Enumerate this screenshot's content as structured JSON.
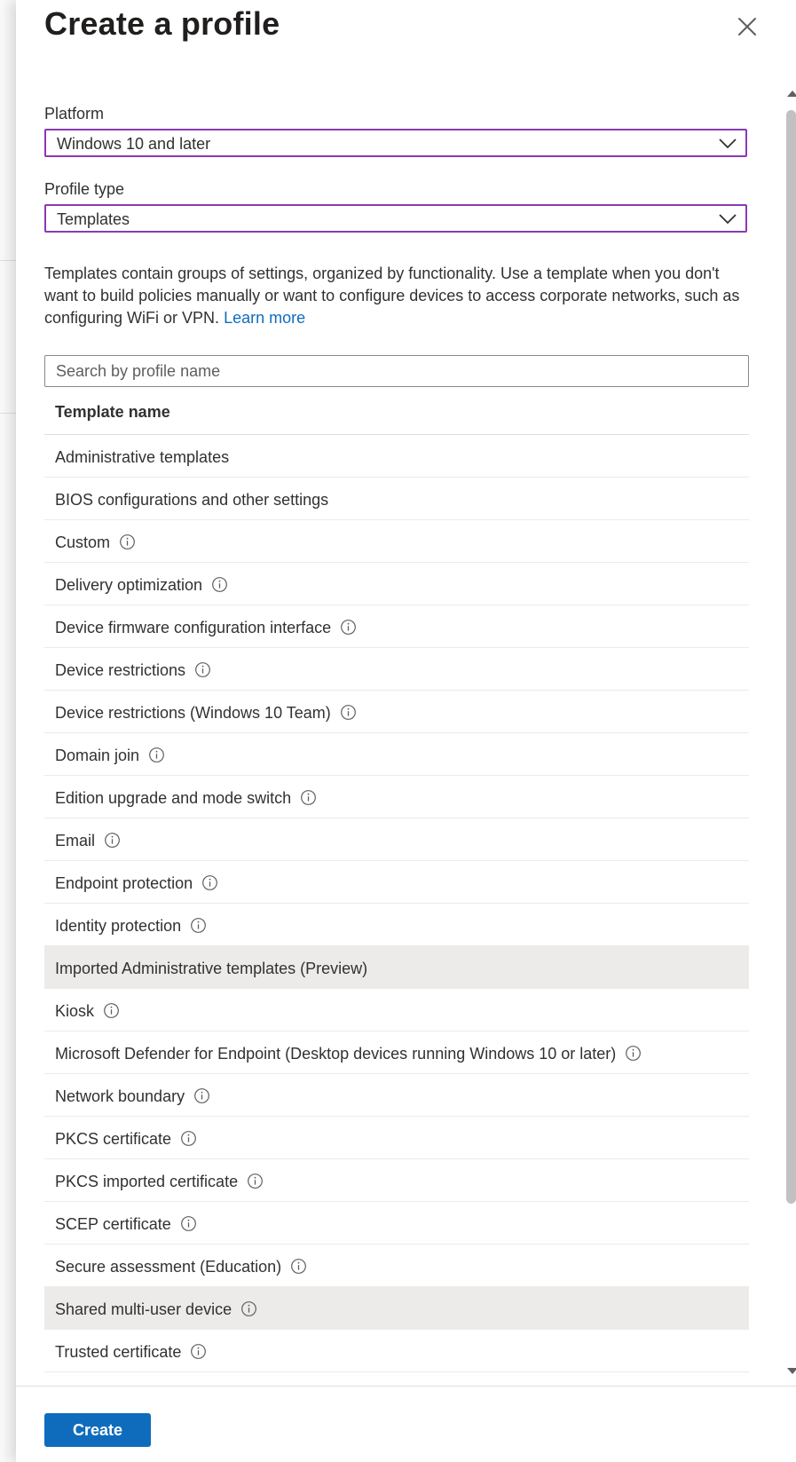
{
  "panel": {
    "title": "Create a profile",
    "close_icon": "close-icon"
  },
  "platform": {
    "label": "Platform",
    "value": "Windows 10 and later"
  },
  "profile_type": {
    "label": "Profile type",
    "value": "Templates"
  },
  "description": {
    "text": "Templates contain groups of settings, organized by functionality. Use a template when you don't want to build policies manually or want to configure devices to access corporate networks, such as configuring WiFi or VPN.",
    "link": "Learn more"
  },
  "search": {
    "placeholder": "Search by profile name",
    "value": ""
  },
  "table": {
    "header": "Template name",
    "rows": [
      {
        "label": "Administrative templates",
        "info": false,
        "highlighted": false
      },
      {
        "label": "BIOS configurations and other settings",
        "info": false,
        "highlighted": false
      },
      {
        "label": "Custom",
        "info": true,
        "highlighted": false
      },
      {
        "label": "Delivery optimization",
        "info": true,
        "highlighted": false
      },
      {
        "label": "Device firmware configuration interface",
        "info": true,
        "highlighted": false
      },
      {
        "label": "Device restrictions",
        "info": true,
        "highlighted": false
      },
      {
        "label": "Device restrictions (Windows 10 Team)",
        "info": true,
        "highlighted": false
      },
      {
        "label": "Domain join",
        "info": true,
        "highlighted": false
      },
      {
        "label": "Edition upgrade and mode switch",
        "info": true,
        "highlighted": false
      },
      {
        "label": "Email",
        "info": true,
        "highlighted": false
      },
      {
        "label": "Endpoint protection",
        "info": true,
        "highlighted": false
      },
      {
        "label": "Identity protection",
        "info": true,
        "highlighted": false
      },
      {
        "label": "Imported Administrative templates (Preview)",
        "info": false,
        "highlighted": true
      },
      {
        "label": "Kiosk",
        "info": true,
        "highlighted": false
      },
      {
        "label": "Microsoft Defender for Endpoint (Desktop devices running Windows 10 or later)",
        "info": true,
        "highlighted": false
      },
      {
        "label": "Network boundary",
        "info": true,
        "highlighted": false
      },
      {
        "label": "PKCS certificate",
        "info": true,
        "highlighted": false
      },
      {
        "label": "PKCS imported certificate",
        "info": true,
        "highlighted": false
      },
      {
        "label": "SCEP certificate",
        "info": true,
        "highlighted": false
      },
      {
        "label": "Secure assessment (Education)",
        "info": true,
        "highlighted": false
      },
      {
        "label": "Shared multi-user device",
        "info": true,
        "highlighted": true
      },
      {
        "label": "Trusted certificate",
        "info": true,
        "highlighted": false
      }
    ]
  },
  "footer": {
    "create_label": "Create"
  },
  "colors": {
    "accent": "#0f6cbd",
    "select_border": "#8b39b5",
    "row_highlight": "#edebe9"
  }
}
